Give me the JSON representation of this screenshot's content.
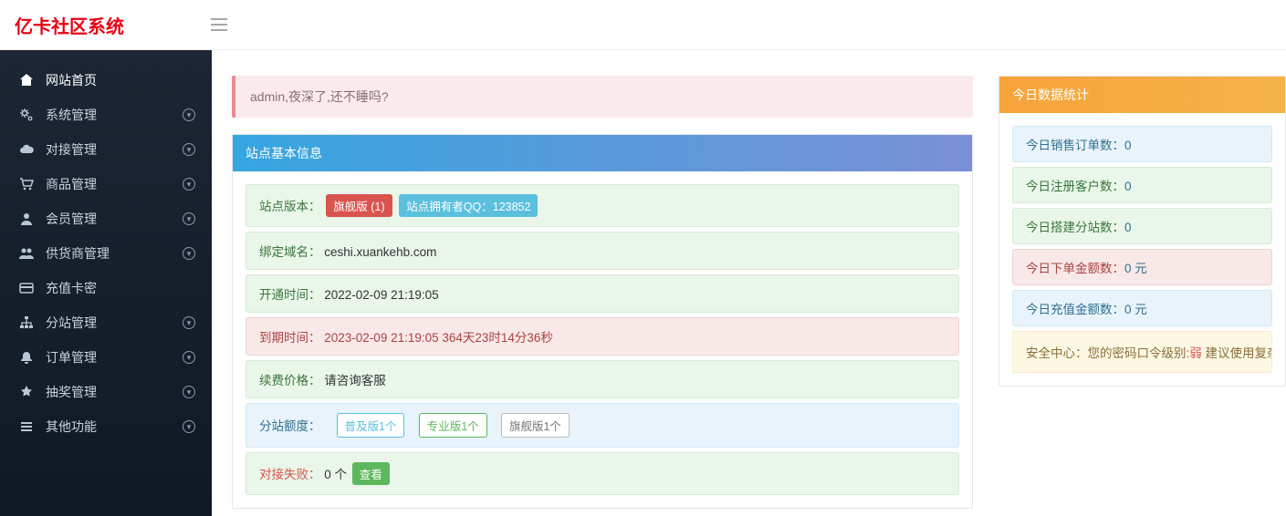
{
  "brand": "亿卡社区系统",
  "greet": "admin,夜深了,还不睡吗?",
  "sidebar": {
    "items": [
      {
        "label": "网站首页",
        "icon": "home",
        "active": true,
        "expand": false
      },
      {
        "label": "系统管理",
        "icon": "gears",
        "active": false,
        "expand": true
      },
      {
        "label": "对接管理",
        "icon": "cloud",
        "active": false,
        "expand": true
      },
      {
        "label": "商品管理",
        "icon": "cart",
        "active": false,
        "expand": true
      },
      {
        "label": "会员管理",
        "icon": "user",
        "active": false,
        "expand": true
      },
      {
        "label": "供货商管理",
        "icon": "users",
        "active": false,
        "expand": true
      },
      {
        "label": "充值卡密",
        "icon": "card",
        "active": false,
        "expand": false
      },
      {
        "label": "分站管理",
        "icon": "sitemap",
        "active": false,
        "expand": true
      },
      {
        "label": "订单管理",
        "icon": "bell",
        "active": false,
        "expand": true
      },
      {
        "label": "抽奖管理",
        "icon": "star",
        "active": false,
        "expand": true
      },
      {
        "label": "其他功能",
        "icon": "list",
        "active": false,
        "expand": true
      }
    ]
  },
  "siteCard": {
    "title": "站点基本信息",
    "versionLabel": "站点版本：",
    "versionBadge": "旗舰版 (1)",
    "ownerBadge": "站点拥有者QQ：123852",
    "domainLabel": "绑定域名：",
    "domainValue": "ceshi.xuankehb.com",
    "openLabel": "开通时间：",
    "openValue": "2022-02-09 21:19:05",
    "expireLabel": "到期时间：",
    "expireValue": "2023-02-09 21:19:05 364天23时14分36秒",
    "renewLabel": "续费价格：",
    "renewValue": "请咨询客服",
    "quotaLabel": "分站额度：",
    "quotaBasic": "普及版1个",
    "quotaPro": "专业版1个",
    "quotaUlt": "旗舰版1个",
    "dockFailLabel": "对接失败：",
    "dockFailValue": "0 个",
    "viewBtn": "查看"
  },
  "statsCard": {
    "title": "今日数据统计",
    "items": [
      {
        "label": "今日销售订单数：",
        "value": "0",
        "cls": "blue"
      },
      {
        "label": "今日注册客户数：",
        "value": "0",
        "cls": "green"
      },
      {
        "label": "今日搭建分站数：",
        "value": "0",
        "cls": "green"
      },
      {
        "label": "今日下单金额数：",
        "value": "0 元",
        "cls": "red"
      },
      {
        "label": "今日充值金额数：",
        "value": "0 元",
        "cls": "blue"
      }
    ],
    "sec": {
      "prefix": "安全中心：",
      "mid": "您的密码口令级别:",
      "level": "弱",
      "suffix": " 建议使用复杂一点密"
    }
  }
}
